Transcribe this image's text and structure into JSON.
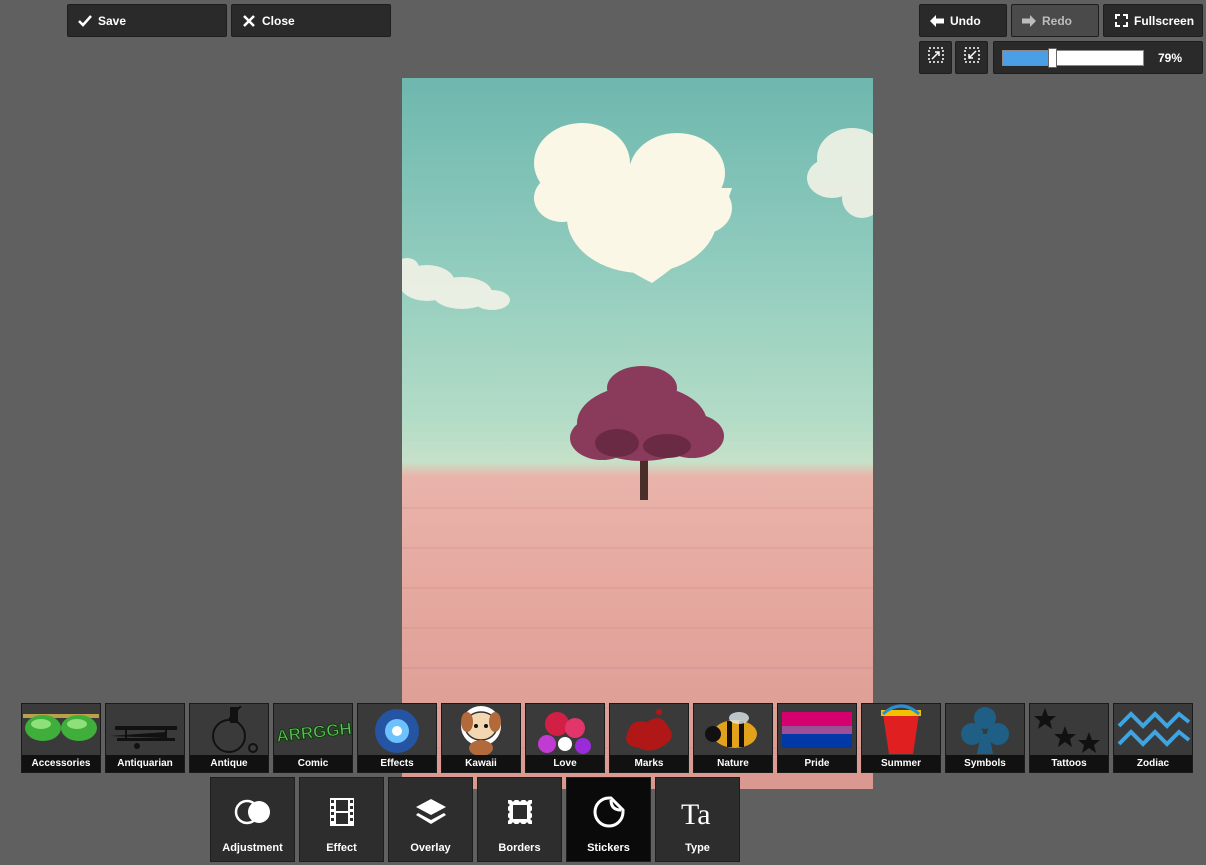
{
  "toolbar": {
    "save_label": "Save",
    "close_label": "Close",
    "undo_label": "Undo",
    "redo_label": "Redo",
    "fullscreen_label": "Fullscreen"
  },
  "zoom": {
    "value_label": "79%",
    "level": 0.35
  },
  "sticker_categories": [
    {
      "label": "Accessories",
      "icon": "sunglasses-icon"
    },
    {
      "label": "Antiquarian",
      "icon": "biplane-icon"
    },
    {
      "label": "Antique",
      "icon": "penny-farthing-icon"
    },
    {
      "label": "Comic",
      "icon": "comic-text-icon"
    },
    {
      "label": "Effects",
      "icon": "sparkle-burst-icon"
    },
    {
      "label": "Kawaii",
      "icon": "cute-puppy-icon"
    },
    {
      "label": "Love",
      "icon": "flowers-icon"
    },
    {
      "label": "Marks",
      "icon": "blood-splat-icon"
    },
    {
      "label": "Nature",
      "icon": "bee-icon"
    },
    {
      "label": "Pride",
      "icon": "pride-flag-icon"
    },
    {
      "label": "Summer",
      "icon": "bucket-icon"
    },
    {
      "label": "Symbols",
      "icon": "club-icon"
    },
    {
      "label": "Tattoos",
      "icon": "stars-icon"
    },
    {
      "label": "Zodiac",
      "icon": "aquarius-icon"
    }
  ],
  "tools": [
    {
      "label": "Adjustment",
      "icon": "adjustment-icon"
    },
    {
      "label": "Effect",
      "icon": "film-icon"
    },
    {
      "label": "Overlay",
      "icon": "layers-icon"
    },
    {
      "label": "Borders",
      "icon": "frame-icon"
    },
    {
      "label": "Stickers",
      "icon": "sticker-icon",
      "active": true
    },
    {
      "label": "Type",
      "icon": "type-icon"
    }
  ],
  "colors": {
    "accent": "#4a9fe6",
    "panel": "#2a2a2a",
    "background": "#606060"
  }
}
